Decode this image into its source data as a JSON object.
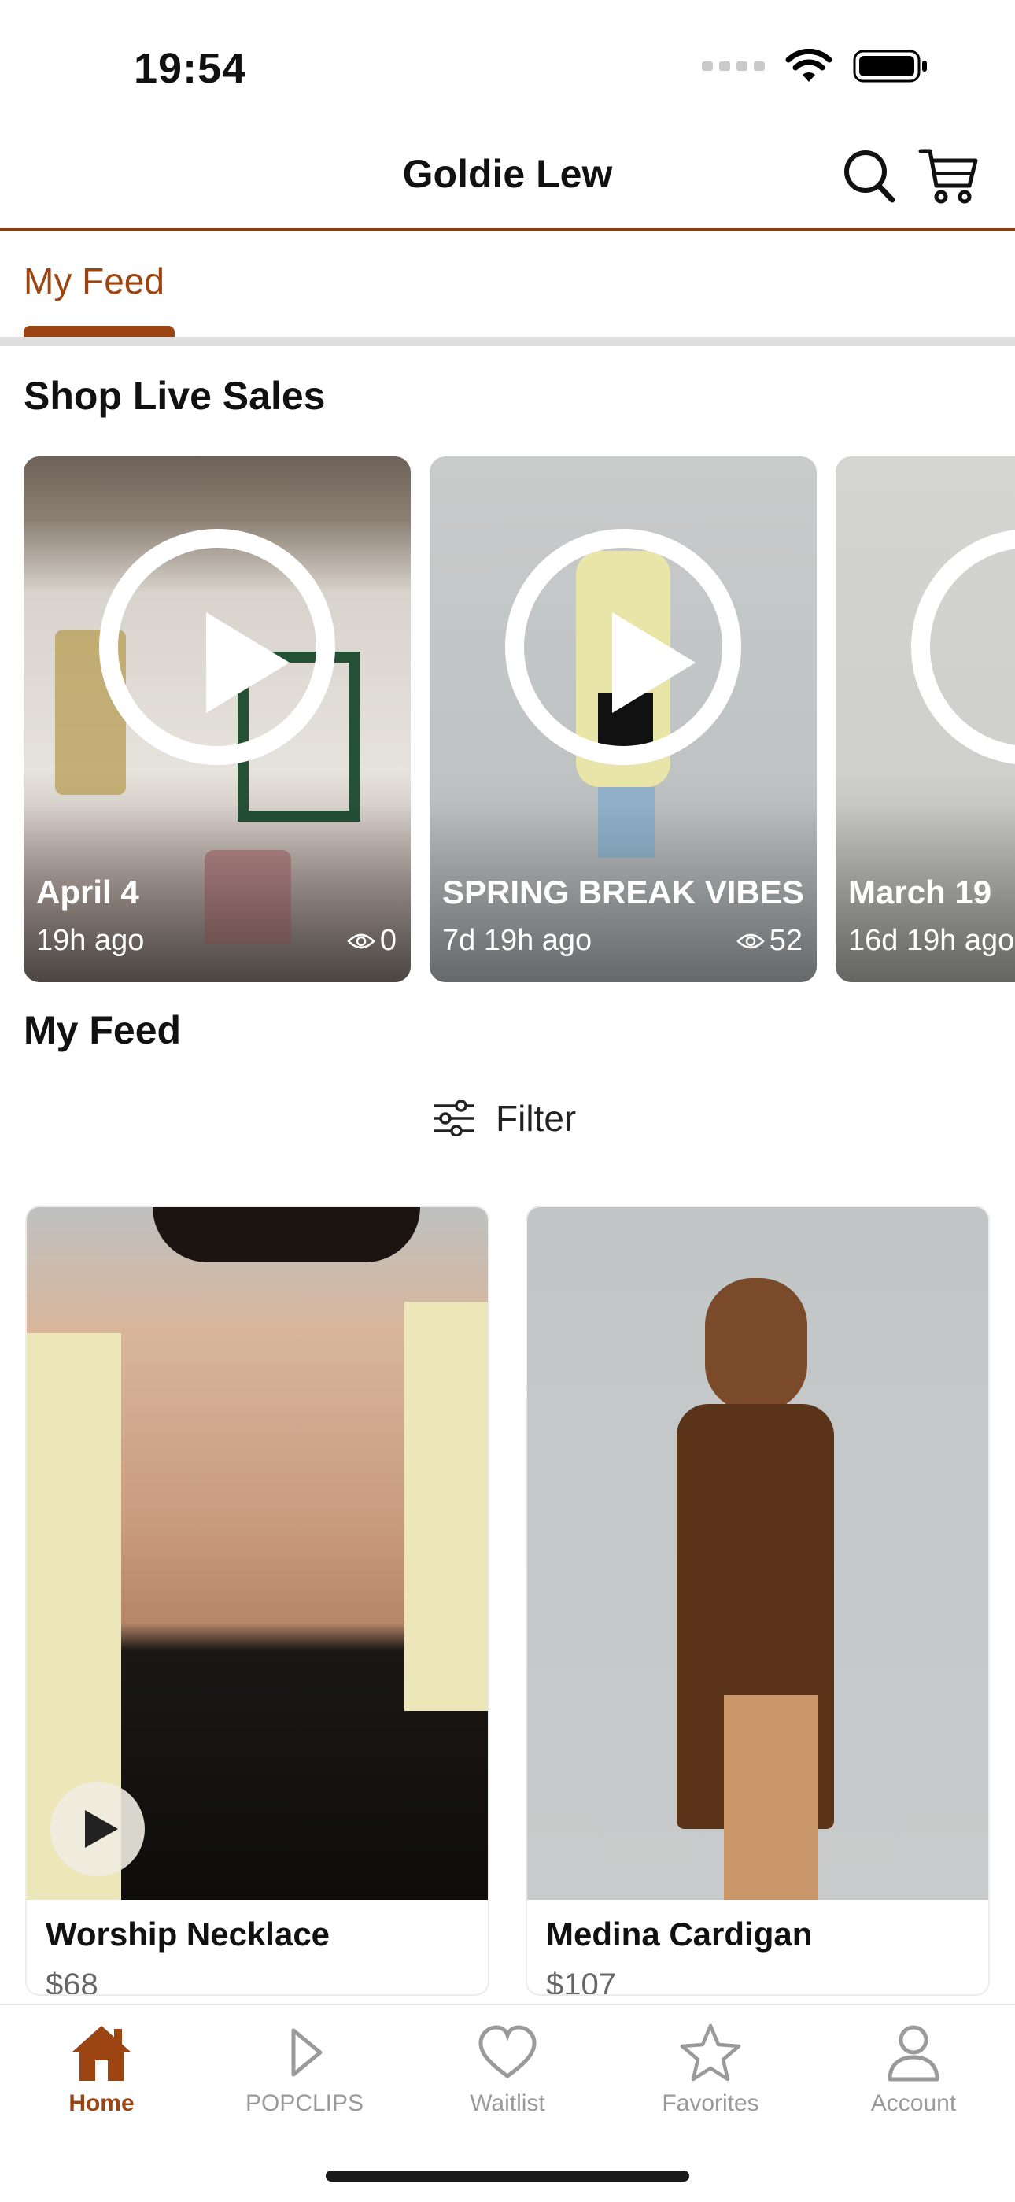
{
  "status_bar": {
    "time": "19:54"
  },
  "header": {
    "title": "Goldie Lew"
  },
  "tabs": [
    {
      "label": "My Feed",
      "active": true
    }
  ],
  "live_sales": {
    "section_title": "Shop Live Sales",
    "items": [
      {
        "title": "April 4",
        "ago": "19h ago",
        "views": "0"
      },
      {
        "title": "SPRING BREAK VIBES",
        "ago": "7d 19h ago",
        "views": "52"
      },
      {
        "title": "March 19",
        "ago": "16d 19h ago",
        "views": ""
      }
    ]
  },
  "feed": {
    "section_title": "My Feed",
    "filter_label": "Filter",
    "products": [
      {
        "name": "Worship Necklace",
        "price": "$68",
        "has_video": true
      },
      {
        "name": "Medina Cardigan",
        "price": "$107",
        "has_video": false
      }
    ]
  },
  "tab_bar": {
    "items": [
      {
        "label": "Home",
        "icon": "home-icon",
        "active": true
      },
      {
        "label": "POPCLIPS",
        "icon": "play-outline-icon",
        "active": false
      },
      {
        "label": "Waitlist",
        "icon": "heart-icon",
        "active": false
      },
      {
        "label": "Favorites",
        "icon": "star-icon",
        "active": false
      },
      {
        "label": "Account",
        "icon": "person-icon",
        "active": false
      }
    ]
  },
  "colors": {
    "accent": "#9c4512",
    "header_rule": "#8b3d12",
    "inactive": "#9a9a9a"
  }
}
